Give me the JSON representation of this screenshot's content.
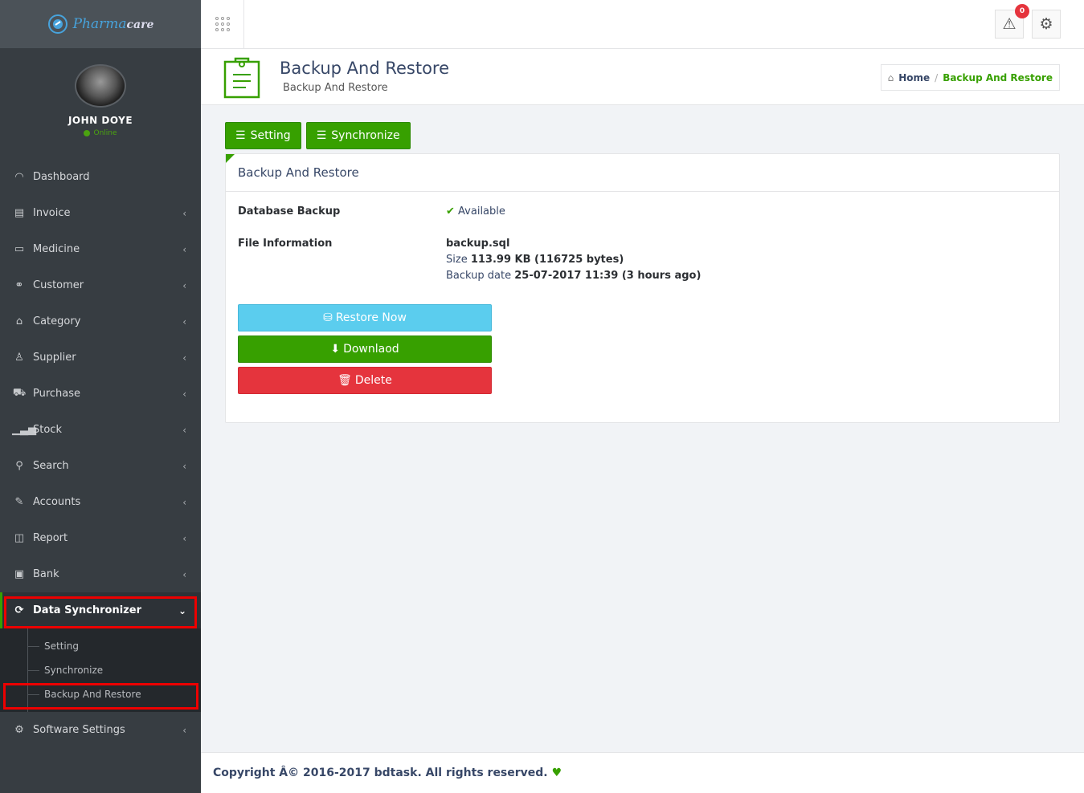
{
  "brand": {
    "logo_main": "Pharma",
    "logo_suffix": "care"
  },
  "user": {
    "name": "JOHN DOYE",
    "status": "Online"
  },
  "sidebar": {
    "items": [
      {
        "label": "Dashboard",
        "icon": "dashboard-icon"
      },
      {
        "label": "Invoice",
        "icon": "invoice-icon"
      },
      {
        "label": "Medicine",
        "icon": "medicine-icon"
      },
      {
        "label": "Customer",
        "icon": "handshake-icon"
      },
      {
        "label": "Category",
        "icon": "bookmark-icon"
      },
      {
        "label": "Supplier",
        "icon": "user-icon"
      },
      {
        "label": "Purchase",
        "icon": "cart-icon"
      },
      {
        "label": "Stock",
        "icon": "bar-chart-icon"
      },
      {
        "label": "Search",
        "icon": "search-icon"
      },
      {
        "label": "Accounts",
        "icon": "edit-icon"
      },
      {
        "label": "Report",
        "icon": "book-icon"
      },
      {
        "label": "Bank",
        "icon": "briefcase-icon"
      },
      {
        "label": "Data Synchronizer",
        "icon": "sync-icon"
      },
      {
        "label": "Software Settings",
        "icon": "gear-icon"
      }
    ],
    "submenu": [
      "Setting",
      "Synchronize",
      "Backup And Restore"
    ]
  },
  "topbar": {
    "notification_count": "0"
  },
  "page": {
    "title": "Backup And Restore",
    "subtitle": "Backup And Restore"
  },
  "breadcrumb": {
    "home": "Home",
    "current": "Backup And Restore"
  },
  "tabs": {
    "setting": "Setting",
    "synchronize": "Synchronize"
  },
  "panel": {
    "heading": "Backup And Restore",
    "db_backup_label": "Database Backup",
    "db_backup_status": "Available",
    "file_info_label": "File Information",
    "file_name": "backup.sql",
    "size_label": "Size",
    "size_value": "113.99 KB (116725 bytes)",
    "date_label": "Backup date",
    "date_value": "25-07-2017 11:39 (3 hours ago)"
  },
  "actions": {
    "restore": "Restore Now",
    "download": "Downlaod",
    "delete": "Delete"
  },
  "colors": {
    "accent": "#37a000",
    "restore": "#5bcdee",
    "delete": "#e5343d",
    "sidebar": "#373d42"
  },
  "footer": {
    "copyright": "Copyright Â© 2016-2017 bdtask. All rights reserved."
  }
}
